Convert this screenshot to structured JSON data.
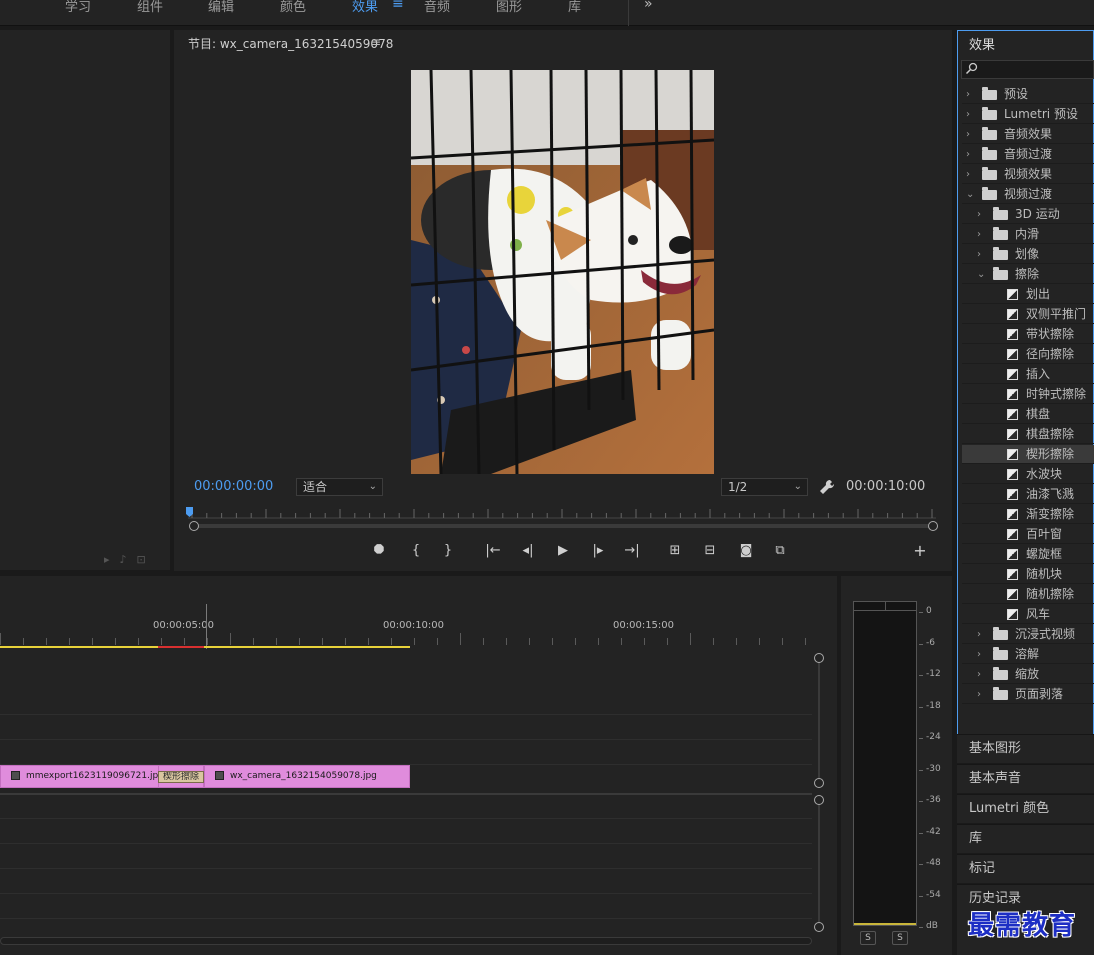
{
  "workspaces": {
    "tabs": [
      "学习",
      "组件",
      "编辑",
      "颜色",
      "效果",
      "音频",
      "图形",
      "库"
    ],
    "active": "效果",
    "more_icon": "double-chevron-right-icon"
  },
  "program_monitor": {
    "title": "节目: wx_camera_1632154059078",
    "timecode_current": "00:00:00:00",
    "timecode_duration": "00:00:10:00",
    "fit_value": "适合",
    "resolution_value": "1/2"
  },
  "timeline": {
    "time_labels": [
      "00:00:05:00",
      "00:00:10:00",
      "00:00:15:00"
    ],
    "clips": [
      {
        "name": "mmexport1623119096721.jpg"
      },
      {
        "name": "wx_camera_1632154059078.jpg"
      }
    ],
    "transition_label": "楔形擦除"
  },
  "audio_meter": {
    "db_labels": [
      "0",
      "-6",
      "-12",
      "-18",
      "-24",
      "-30",
      "-36",
      "-42",
      "-48",
      "-54",
      "dB"
    ],
    "solo_labels": [
      "S",
      "S"
    ]
  },
  "effects_panel": {
    "title": "效果",
    "items": [
      {
        "label": "预设",
        "kind": "folder-star",
        "level": 0,
        "expanded": false
      },
      {
        "label": "Lumetri 预设",
        "kind": "folder-star",
        "level": 0,
        "expanded": false
      },
      {
        "label": "音频效果",
        "kind": "folder",
        "level": 0,
        "expanded": false
      },
      {
        "label": "音频过渡",
        "kind": "folder",
        "level": 0,
        "expanded": false
      },
      {
        "label": "视频效果",
        "kind": "folder",
        "level": 0,
        "expanded": false
      },
      {
        "label": "视频过渡",
        "kind": "folder",
        "level": 0,
        "expanded": true
      },
      {
        "label": "3D 运动",
        "kind": "folder",
        "level": 1,
        "expanded": false
      },
      {
        "label": "内滑",
        "kind": "folder",
        "level": 1,
        "expanded": false
      },
      {
        "label": "划像",
        "kind": "folder",
        "level": 1,
        "expanded": false
      },
      {
        "label": "擦除",
        "kind": "folder",
        "level": 1,
        "expanded": true
      },
      {
        "label": "划出",
        "kind": "transition",
        "level": 2
      },
      {
        "label": "双侧平推门",
        "kind": "transition",
        "level": 2
      },
      {
        "label": "带状擦除",
        "kind": "transition",
        "level": 2
      },
      {
        "label": "径向擦除",
        "kind": "transition",
        "level": 2
      },
      {
        "label": "插入",
        "kind": "transition",
        "level": 2
      },
      {
        "label": "时钟式擦除",
        "kind": "transition",
        "level": 2
      },
      {
        "label": "棋盘",
        "kind": "transition",
        "level": 2
      },
      {
        "label": "棋盘擦除",
        "kind": "transition",
        "level": 2
      },
      {
        "label": "楔形擦除",
        "kind": "transition",
        "level": 2,
        "selected": true
      },
      {
        "label": "水波块",
        "kind": "transition",
        "level": 2
      },
      {
        "label": "油漆飞溅",
        "kind": "transition",
        "level": 2
      },
      {
        "label": "渐变擦除",
        "kind": "transition",
        "level": 2
      },
      {
        "label": "百叶窗",
        "kind": "transition",
        "level": 2
      },
      {
        "label": "螺旋框",
        "kind": "transition",
        "level": 2
      },
      {
        "label": "随机块",
        "kind": "transition",
        "level": 2
      },
      {
        "label": "随机擦除",
        "kind": "transition",
        "level": 2
      },
      {
        "label": "风车",
        "kind": "transition",
        "level": 2
      },
      {
        "label": "沉浸式视频",
        "kind": "folder",
        "level": 1,
        "expanded": false
      },
      {
        "label": "溶解",
        "kind": "folder",
        "level": 1,
        "expanded": false
      },
      {
        "label": "缩放",
        "kind": "folder",
        "level": 1,
        "expanded": false
      },
      {
        "label": "页面剥落",
        "kind": "folder",
        "level": 1,
        "expanded": false
      }
    ]
  },
  "side_panels": [
    "基本图形",
    "基本声音",
    "Lumetri 颜色",
    "库",
    "标记",
    "历史记录"
  ],
  "watermark": "最需教育",
  "colors": {
    "accent": "#4d9cf0",
    "clip": "#e08cdc",
    "work_area": "#e8d23a",
    "render_bar": "#d83030"
  }
}
